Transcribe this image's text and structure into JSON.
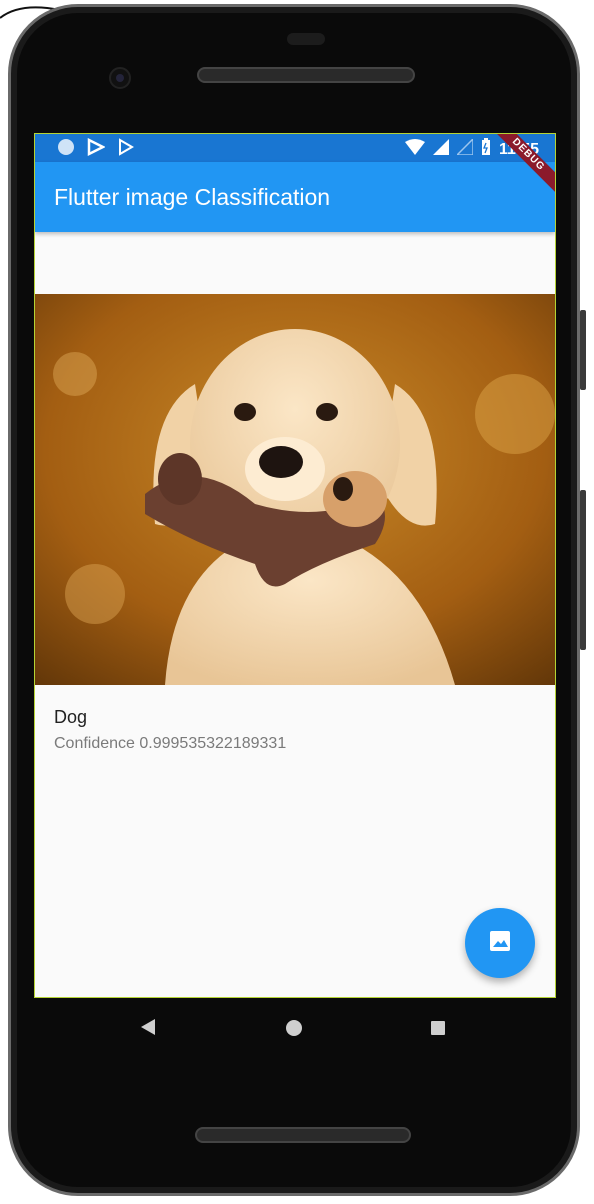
{
  "status_bar": {
    "time": "11:55",
    "icons": [
      "circle-icon",
      "play-store-icon",
      "play-icon",
      "wifi-icon",
      "signal-icon",
      "signal-empty-icon",
      "battery-icon"
    ]
  },
  "app_bar": {
    "title": "Flutter image Classification",
    "debug_banner": "DEBUG"
  },
  "result": {
    "image": "golden-retriever-puppy-with-toy",
    "label": "Dog",
    "confidence": "Confidence 0.999535322189331"
  },
  "fab": {
    "icon": "image-icon"
  },
  "nav": {
    "icons": [
      "back-icon",
      "home-icon",
      "recents-icon"
    ]
  },
  "colors": {
    "primary": "#2196f3",
    "status_bar": "#1976d2",
    "background": "#fafafa"
  }
}
